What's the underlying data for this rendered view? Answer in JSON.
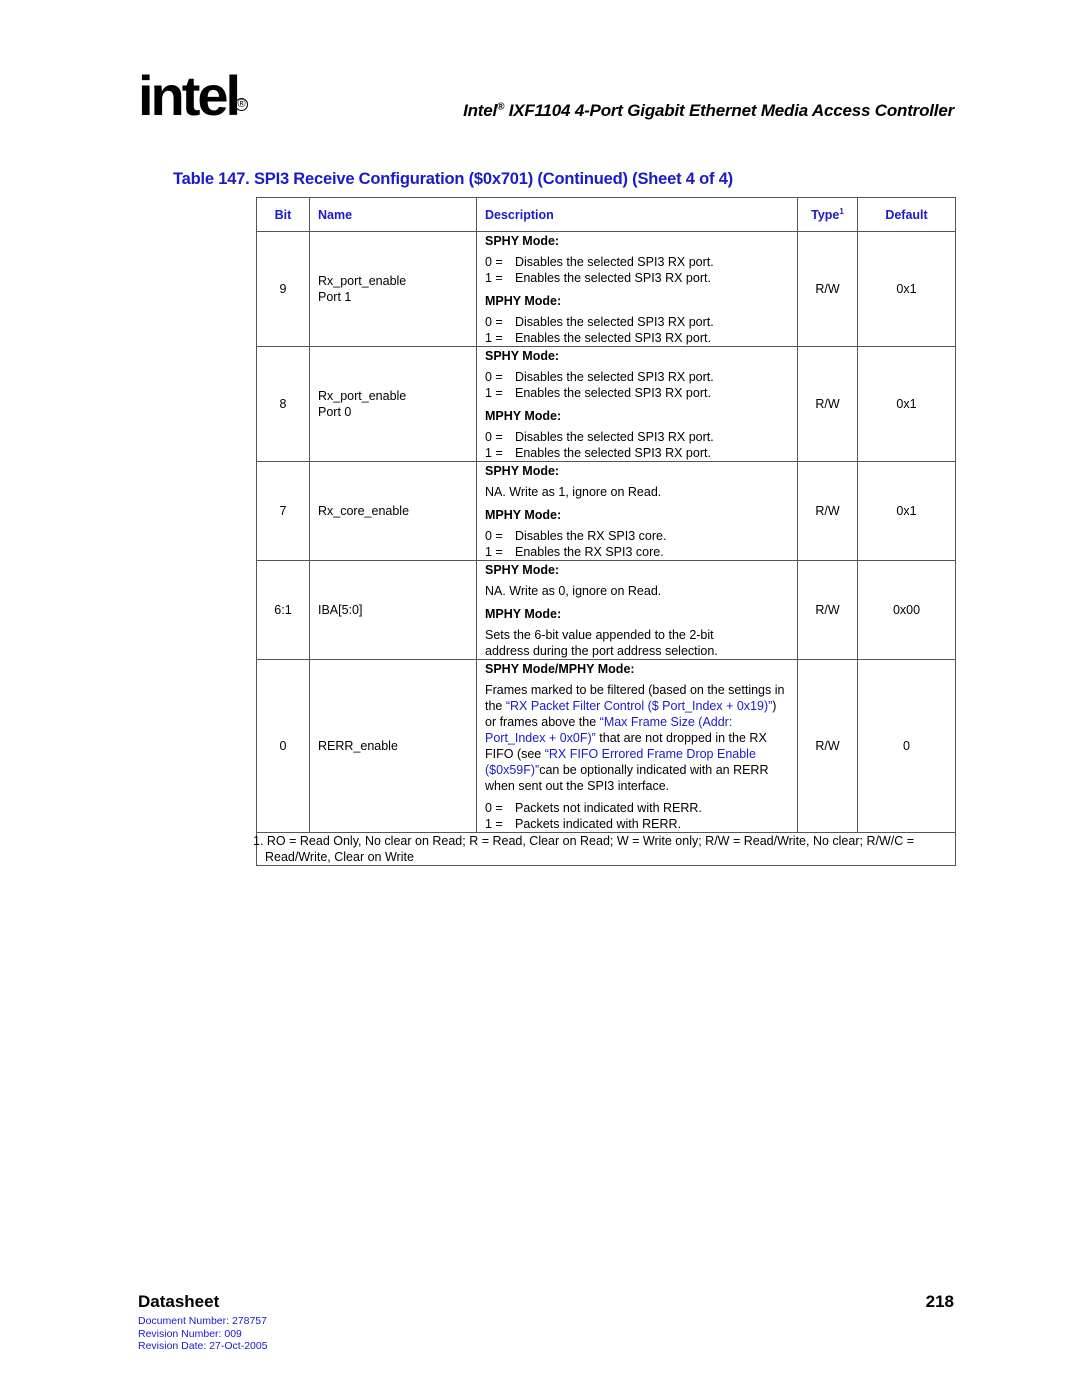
{
  "header": {
    "logo_text": "intel",
    "logo_reg": "®",
    "title_prefix": "Intel",
    "title_reg": "®",
    "title_rest": " IXF1104 4-Port Gigabit Ethernet Media Access Controller"
  },
  "table": {
    "caption": "Table 147. SPI3 Receive Configuration ($0x701) (Continued) (Sheet 4 of 4)",
    "columns": {
      "bit": "Bit",
      "name": "Name",
      "description": "Description",
      "type": "Type",
      "type_footnote": "1",
      "default": "Default"
    },
    "rows": [
      {
        "bit": "9",
        "name": [
          "Rx_port_enable",
          "Port 1"
        ],
        "type": "R/W",
        "default": "0x1",
        "sphy_label": "SPHY Mode:",
        "sphy": [
          {
            "k": "0 =",
            "v": "Disables the selected SPI3 RX port."
          },
          {
            "k": "1 =",
            "v": "Enables the selected SPI3 RX port."
          }
        ],
        "mphy_label": "MPHY Mode:",
        "mphy": [
          {
            "k": "0 =",
            "v": "Disables the selected SPI3 RX port."
          },
          {
            "k": "1 =",
            "v": "Enables the selected SPI3 RX port."
          }
        ]
      },
      {
        "bit": "8",
        "name": [
          "Rx_port_enable",
          "Port 0"
        ],
        "type": "R/W",
        "default": "0x1",
        "sphy_label": "SPHY Mode:",
        "sphy": [
          {
            "k": "0 =",
            "v": "Disables the selected SPI3 RX port."
          },
          {
            "k": "1 =",
            "v": "Enables the selected SPI3 RX port."
          }
        ],
        "mphy_label": "MPHY Mode:",
        "mphy": [
          {
            "k": "0 =",
            "v": "Disables the selected SPI3 RX port."
          },
          {
            "k": "1 =",
            "v": "Enables the selected SPI3 RX port."
          }
        ]
      },
      {
        "bit": "7",
        "name": [
          "Rx_core_enable"
        ],
        "type": "R/W",
        "default": "0x1",
        "sphy_label": "SPHY Mode:",
        "sphy_text": "NA. Write as 1, ignore on Read.",
        "mphy_label": "MPHY Mode:",
        "mphy": [
          {
            "k": "0 =",
            "v": "Disables the RX SPI3 core."
          },
          {
            "k": "1 =",
            "v": "Enables the RX SPI3 core."
          }
        ]
      },
      {
        "bit": "6:1",
        "name": [
          "IBA[5:0]"
        ],
        "type": "R/W",
        "default": "0x00",
        "sphy_label": "SPHY Mode:",
        "sphy_text": "NA. Write as 0, ignore on Read.",
        "mphy_label": "MPHY Mode:",
        "mphy_text": [
          "Sets the 6-bit value appended to the 2-bit",
          "address during the port address selection."
        ]
      },
      {
        "bit": "0",
        "name": [
          "RERR_enable"
        ],
        "type": "R/W",
        "default": "0",
        "mode_label": "SPHY Mode/MPHY Mode:",
        "para": {
          "t1": "Frames marked to be filtered (based on the settings in the ",
          "l1": "“RX Packet Filter Control ($ Port_Index + 0x19)”",
          "t2": ") or frames above the ",
          "l2": "“Max Frame Size (Addr: Port_Index + 0x0F)”",
          "t3": " that are not dropped in the RX FIFO (see ",
          "l3": "“RX FIFO Errored Frame Drop Enable ($0x59F)”",
          "t4": "can be optionally indicated with an RERR when sent out the SPI3 interface."
        },
        "values": [
          {
            "k": "0 =",
            "v": "Packets not indicated with RERR."
          },
          {
            "k": "1 =",
            "v": "Packets indicated with RERR."
          }
        ]
      }
    ],
    "footnote": "1. RO = Read Only, No clear on Read; R = Read, Clear on Read; W = Write only; R/W = Read/Write, No clear; R/W/C = Read/Write, Clear on Write"
  },
  "footer": {
    "section": "Datasheet",
    "page": "218",
    "doc_number": "Document Number: 278757",
    "revision_number": "Revision Number: 009",
    "revision_date": "Revision Date: 27-Oct-2005"
  }
}
